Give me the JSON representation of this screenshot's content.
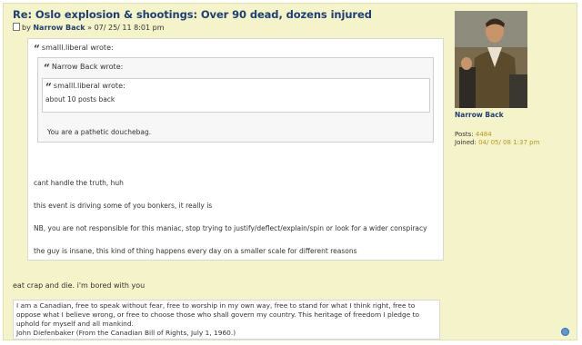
{
  "post": {
    "title": "Re: Oslo explosion & shootings: Over 90 dead, dozens injured",
    "by_label": "by",
    "author": "Narrow Back",
    "date": "» 07/ 25/ 11 8:01 pm"
  },
  "profile": {
    "name": "Narrow Back",
    "posts_label": "Posts:",
    "posts_value": "4484",
    "joined_label": "Joined:",
    "joined_value": "04/ 05/ 08 1:37 pm"
  },
  "quotes": {
    "outer_author": "smalll.liberal wrote:",
    "middle_author": "Narrow Back wrote:",
    "inner_author": "smalll.liberal wrote:",
    "inner_text": "about 10 posts back",
    "middle_reply": "You are a pathetic douchebag."
  },
  "body": {
    "lines": [
      "cant handle the truth, huh",
      "this event is driving some of you bonkers, it really is",
      "NB, you are not responsible for this maniac, stop trying to justify/deflect/explain/spin or look for a wider conspiracy",
      "the guy is insane, this kind of thing happens every day on a smaller scale for different reasons"
    ],
    "reply": "eat crap and die. i'm bored with you"
  },
  "signature": {
    "line1": "I am a Canadian, free to speak without fear, free to worship in my own way, free to stand for what I think right, free to",
    "line2": "oppose what I believe wrong, or free to choose those who shall govern my country. This heritage of freedom I pledge to",
    "line3": "uphold for myself and all mankind.",
    "line4": "John Diefenbaker (From the Canadian Bill of Rights, July 1, 1960.)"
  }
}
